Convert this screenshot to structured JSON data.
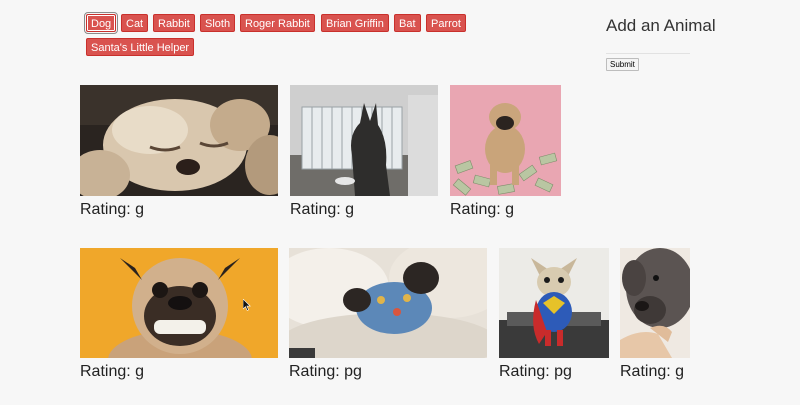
{
  "buttons": [
    {
      "label": "Dog",
      "active": true
    },
    {
      "label": "Cat",
      "active": false
    },
    {
      "label": "Rabbit",
      "active": false
    },
    {
      "label": "Sloth",
      "active": false
    },
    {
      "label": "Roger Rabbit",
      "active": false
    },
    {
      "label": "Brian Griffin",
      "active": false
    },
    {
      "label": "Bat",
      "active": false
    },
    {
      "label": "Parrot",
      "active": false
    },
    {
      "label": "Santa's Little Helper",
      "active": false
    }
  ],
  "form": {
    "title": "Add an Animal",
    "input_value": "",
    "submit_label": "Submit"
  },
  "gifs": [
    {
      "rating_label": "Rating: g",
      "subject": "sleepy puppy"
    },
    {
      "rating_label": "Rating: g",
      "subject": "dog at crate"
    },
    {
      "rating_label": "Rating: g",
      "subject": "pug on money"
    },
    {
      "rating_label": "Rating: g",
      "subject": "smiling pug"
    },
    {
      "rating_label": "Rating: pg",
      "subject": "pug in bed"
    },
    {
      "rating_label": "Rating: pg",
      "subject": "superman chihuahua"
    },
    {
      "rating_label": "Rating: g",
      "subject": "dog sniffing hand"
    }
  ],
  "colors": {
    "button_bg": "#d9534f",
    "button_text": "#ffffff",
    "page_bg": "#f7f7f7",
    "rating_text": "#222222"
  }
}
